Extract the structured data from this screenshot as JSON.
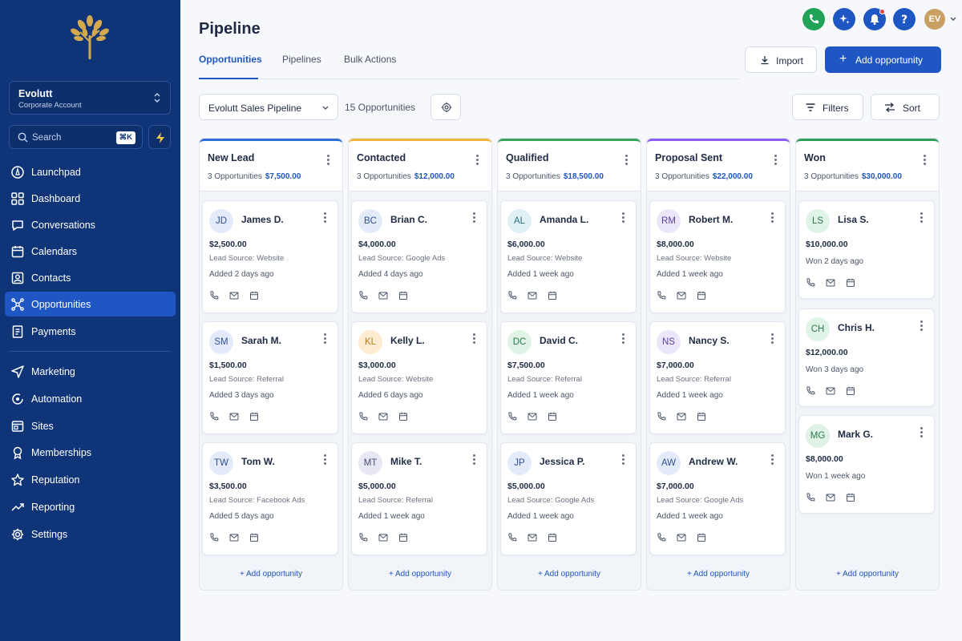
{
  "sidebar": {
    "account": {
      "name": "Evolutt",
      "subtitle": "Corporate Account"
    },
    "search": {
      "placeholder": "Search",
      "shortcut": "⌘K"
    },
    "items": [
      {
        "label": "Launchpad",
        "icon": "rocket-icon"
      },
      {
        "label": "Dashboard",
        "icon": "grid-icon"
      },
      {
        "label": "Conversations",
        "icon": "chat-icon"
      },
      {
        "label": "Calendars",
        "icon": "calendar-icon"
      },
      {
        "label": "Contacts",
        "icon": "contacts-icon"
      },
      {
        "label": "Opportunities",
        "icon": "opportunities-icon",
        "active": true
      },
      {
        "label": "Payments",
        "icon": "payments-icon"
      },
      {
        "label": "Marketing",
        "icon": "send-icon"
      },
      {
        "label": "Automation",
        "icon": "automation-icon"
      },
      {
        "label": "Sites",
        "icon": "sites-icon"
      },
      {
        "label": "Memberships",
        "icon": "badge-icon"
      },
      {
        "label": "Reputation",
        "icon": "star-icon"
      },
      {
        "label": "Reporting",
        "icon": "trend-icon"
      },
      {
        "label": "Settings",
        "icon": "gear-icon"
      }
    ]
  },
  "header": {
    "title": "Pipeline",
    "tabs": [
      {
        "label": "Opportunities",
        "active": true
      },
      {
        "label": "Pipelines"
      },
      {
        "label": "Bulk Actions"
      }
    ],
    "import_label": "Import",
    "add_label": "Add opportunity",
    "user_initials": "EV"
  },
  "toolbar": {
    "pipeline_select": "Evolutt Sales Pipeline",
    "count": "15 Opportunities",
    "filters_label": "Filters",
    "sort_label": "Sort"
  },
  "colors": {
    "accent": "#1e56c3",
    "sidebar": "#0f3578"
  },
  "columns": [
    {
      "title": "New Lead",
      "count": "3 Opportunities",
      "amount": "$7,500.00",
      "color": "#2f6fd6",
      "add_label": "+ Add opportunity",
      "cards": [
        {
          "initials": "JD",
          "name": "James D.",
          "value": "$2,500.00",
          "source": "Lead Source: Website",
          "added": "Added 2 days ago",
          "av_bg": "#e3ebfb",
          "av_fg": "#2f4f8f"
        },
        {
          "initials": "SM",
          "name": "Sarah M.",
          "value": "$1,500.00",
          "source": "Lead Source: Referral",
          "added": "Added 3 days ago",
          "av_bg": "#e3ebfb",
          "av_fg": "#2f4f8f"
        },
        {
          "initials": "TW",
          "name": "Tom W.",
          "value": "$3,500.00",
          "source": "Lead Source: Facebook Ads",
          "added": "Added 5 days ago",
          "av_bg": "#e3ebfb",
          "av_fg": "#2f4f8f"
        }
      ]
    },
    {
      "title": "Contacted",
      "count": "3 Opportunities",
      "amount": "$12,000.00",
      "color": "#f0b43c",
      "add_label": "+ Add opportunity",
      "cards": [
        {
          "initials": "BC",
          "name": "Brian C.",
          "value": "$4,000.00",
          "source": "Lead Source: Google Ads",
          "added": "Added 4 days ago",
          "av_bg": "#e3ebfb",
          "av_fg": "#2f4f8f"
        },
        {
          "initials": "KL",
          "name": "Kelly L.",
          "value": "$3,000.00",
          "source": "Lead Source: Website",
          "added": "Added 6 days ago",
          "av_bg": "#fdebd2",
          "av_fg": "#b7791f"
        },
        {
          "initials": "MT",
          "name": "Mike T.",
          "value": "$5,000.00",
          "source": "Lead Source: Referral",
          "added": "Added 1 week ago",
          "av_bg": "#e8e8f5",
          "av_fg": "#4a4a7a"
        }
      ]
    },
    {
      "title": "Qualified",
      "count": "3 Opportunities",
      "amount": "$18,500.00",
      "color": "#3aa35a",
      "add_label": "+ Add opportunity",
      "cards": [
        {
          "initials": "AL",
          "name": "Amanda L.",
          "value": "$6,000.00",
          "source": "Lead Source: Website",
          "added": "Added 1 week ago",
          "av_bg": "#dff1f5",
          "av_fg": "#2c6f80"
        },
        {
          "initials": "DC",
          "name": "David C.",
          "value": "$7,500.00",
          "source": "Lead Source: Referral",
          "added": "Added 1 week ago",
          "av_bg": "#dff4e6",
          "av_fg": "#2d7a48"
        },
        {
          "initials": "JP",
          "name": "Jessica P.",
          "value": "$5,000.00",
          "source": "Lead Source: Google Ads",
          "added": "Added 1 week ago",
          "av_bg": "#e3ebfb",
          "av_fg": "#2f4f8f"
        }
      ]
    },
    {
      "title": "Proposal Sent",
      "count": "3 Opportunities",
      "amount": "$22,000.00",
      "color": "#8b5cf6",
      "add_label": "+ Add opportunity",
      "cards": [
        {
          "initials": "RM",
          "name": "Robert M.",
          "value": "$8,000.00",
          "source": "Lead Source: Website",
          "added": "Added 1 week ago",
          "av_bg": "#ece6fb",
          "av_fg": "#5a3f9a"
        },
        {
          "initials": "NS",
          "name": "Nancy S.",
          "value": "$7,000.00",
          "source": "Lead Source: Referral",
          "added": "Added 1 week ago",
          "av_bg": "#ece6fb",
          "av_fg": "#5a3f9a"
        },
        {
          "initials": "AW",
          "name": "Andrew W.",
          "value": "$7,000.00",
          "source": "Lead Source: Google Ads",
          "added": "Added 1 week ago",
          "av_bg": "#e3ebfb",
          "av_fg": "#2f4f8f"
        }
      ]
    },
    {
      "title": "Won",
      "count": "3 Opportunities",
      "amount": "$30,000.00",
      "color": "#2f9e5a",
      "add_label": "+ Add opportunity",
      "cards": [
        {
          "initials": "LS",
          "name": "Lisa S.",
          "value": "$10,000.00",
          "added": "Won 2 days ago",
          "av_bg": "#dff4e6",
          "av_fg": "#2d7a48"
        },
        {
          "initials": "CH",
          "name": "Chris H.",
          "value": "$12,000.00",
          "added": "Won 3 days ago",
          "av_bg": "#dff4e6",
          "av_fg": "#2d7a48"
        },
        {
          "initials": "MG",
          "name": "Mark G.",
          "value": "$8,000.00",
          "added": "Won 1 week ago",
          "av_bg": "#dff4e6",
          "av_fg": "#2d7a48"
        }
      ]
    }
  ]
}
